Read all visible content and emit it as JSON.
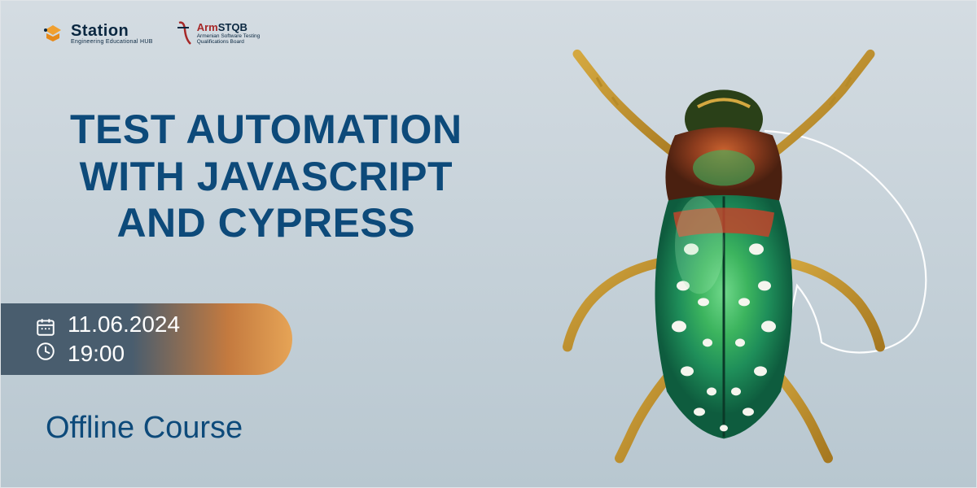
{
  "logos": {
    "station": {
      "name": "Station",
      "tagline": "Engineering Educational HUB"
    },
    "armstqb": {
      "prefix": "Arm",
      "suffix": "STQB",
      "line1": "Armenian Software Testing",
      "line2": "Qualifications Board"
    }
  },
  "title": {
    "line1": "TEST AUTOMATION",
    "line2": "WITH JAVASCRIPT",
    "line3": "AND CYPRESS"
  },
  "datetime": {
    "date": "11.06.2024",
    "time": "19:00"
  },
  "course_type": "Offline Course"
}
